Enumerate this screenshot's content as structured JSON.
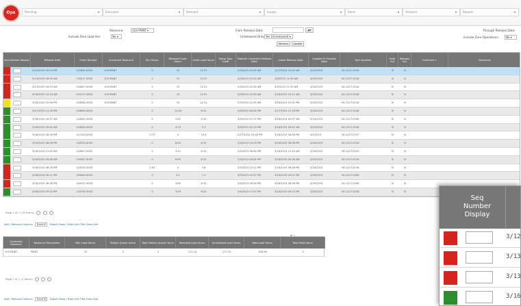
{
  "app": {
    "logo_text": "Ops"
  },
  "nav": [
    {
      "label": "Planning"
    },
    {
      "label": "Execution"
    },
    {
      "label": "Demand"
    },
    {
      "label": "Supply"
    },
    {
      "label": "Items"
    },
    {
      "label": "Analyzer"
    },
    {
      "label": "Reports"
    }
  ],
  "filters": {
    "resource_label": "Resource:",
    "resource_value": "103-PAINT",
    "zero_load_label": "Include Zero Load Hrs:",
    "zero_load_value": "No",
    "from_date_label": "From Release Date:",
    "unreleased_label": "Unreleased Only:",
    "unreleased_value": "Yes (Unreleased)",
    "through_date_label": "Through Release Date:",
    "zero_ops_label": "Include Zero Operations:",
    "zero_ops_value": "No",
    "retrieve_label": "Retrieve",
    "update_label": "Update"
  },
  "grid": {
    "columns": [
      "Seq Number Display",
      "Release Date",
      "Order Number",
      "Constraint Resource",
      "Run Hours",
      "Released Load Hours",
      "Order Load Hours",
      "Setup Type Code",
      "Material Constraint Release Date",
      "Latest Release Date",
      "Capable To Promise Date",
      "Item Number",
      "Hold Ind",
      "Release Ind",
      "Comment 1",
      "Comment"
    ],
    "rows": [
      {
        "status": "red",
        "release": "2/13/2015 09:14 PM",
        "order": "115854-0004",
        "constraint": "103-PAINT",
        "run": "0",
        "released": "15",
        "load": "12.51",
        "mat": "2/3/2015 02:45 AM",
        "latest": "12/7/2015 10:00 AM",
        "ctp": "2/20/2015",
        "item": "04-1227-0216",
        "hold": "N",
        "rel": "N"
      },
      {
        "status": "red",
        "release": "3/13/2015 04:35 AM",
        "order": "116417-0004",
        "constraint": "103-PAINT",
        "run": "0",
        "released": "15",
        "load": "12.51",
        "mat": "2/3/2015 02:45 AM",
        "latest": "3/9/2015 11:55 AM",
        "ctp": "3/20/2015",
        "item": "04-1227-0216",
        "hold": "N",
        "rel": "N"
      },
      {
        "status": "red",
        "release": "3/13/2015 04:53 AM",
        "order": "116407-0004",
        "constraint": "103-PAINT",
        "run": "0",
        "released": "15",
        "load": "12.51",
        "mat": "2/3/2015 02:45 AM",
        "latest": "3/9/2015 11:55 AM",
        "ctp": "3/20/2015",
        "item": "04-1227-0216",
        "hold": "N",
        "rel": "N"
      },
      {
        "status": "red",
        "release": "3/16/2015 10:13 AM",
        "order": "116117-0004",
        "constraint": "103-PAINT",
        "run": "0",
        "released": "15",
        "load": "12.51",
        "mat": "2/3/2015 02:45 AM",
        "latest": "3/16/2015 10:11 AM",
        "ctp": "3/20/2015",
        "item": "04-1227-0216",
        "hold": "N",
        "rel": "N"
      },
      {
        "status": "yellow",
        "release": "3/16/2015 10:58 PM",
        "order": "116584-0003",
        "constraint": "103-PAINT",
        "run": "0",
        "released": "15",
        "load": "12.51",
        "mat": "2/3/2015 02:45 AM",
        "latest": "3/16/2015 10:31 PM",
        "ctp": "3/20/2015",
        "item": "04-1227-0216",
        "hold": "N",
        "rel": "N"
      },
      {
        "status": "green",
        "release": "3/17/2015 11:18 PM",
        "order": "116604-0003",
        "constraint": "",
        "run": "0",
        "released": "12.85",
        "load": "6.31",
        "mat": "2/3/2015 06:34 PM",
        "latest": "2/17/2015 11:18 PM",
        "ctp": "3/20/2015",
        "item": "04-1227-0216",
        "hold": "N",
        "rel": "N"
      },
      {
        "status": "green",
        "release": "3/16/2015 04:37 AM",
        "order": "116091-0003",
        "constraint": "",
        "run": "0",
        "released": "3.81",
        "load": "6.31",
        "mat": "3/4/2015 07:11 PM",
        "latest": "3/16/2015 04:37 AM",
        "ctp": "3/24/2015",
        "item": "04-1227-0206",
        "hold": "N",
        "rel": "N"
      },
      {
        "status": "green",
        "release": "3/16/2015 09:42 AM",
        "order": "116504-0003",
        "constraint": "",
        "run": "0",
        "released": "4.79",
        "load": "3.1",
        "mat": "3/5/2015 02:19 PM",
        "latest": "3/16/2015 09:42 AM",
        "ctp": "3/20/2015",
        "item": "04-1227-0216",
        "hold": "N",
        "rel": "N"
      },
      {
        "status": "green",
        "release": "3/16/2015 06:26 PM",
        "order": "117140-0009",
        "constraint": "",
        "run": "2.73",
        "released": "0",
        "load": "14.4",
        "mat": "2/27/2015 03:48 PM",
        "latest": "3/16/2015 06:26 PM",
        "ctp": "4/1/2015",
        "item": "04-1227-0707",
        "hold": "N",
        "rel": "N"
      },
      {
        "status": "green",
        "release": "3/19/2015 06:28 PM",
        "order": "116720-0003",
        "constraint": "",
        "run": "0",
        "released": "6.45",
        "load": "6.31",
        "mat": "2/4/2015 04:19 PM",
        "latest": "3/19/2015 06:28 PM",
        "ctp": "3/20/2015",
        "item": "04-1227-0216",
        "hold": "N",
        "rel": "N"
      },
      {
        "status": "green",
        "release": "3/20/2015 11:50 AM",
        "order": "116407-0002",
        "constraint": "",
        "run": "0",
        "released": "3.21",
        "load": "6.31",
        "mat": "2/4/2015 06:34 PM",
        "latest": "3/16/2015 11:50 AM",
        "ctp": "3/20/2015",
        "item": "04-1227-0222",
        "hold": "N",
        "rel": "N"
      },
      {
        "status": "green",
        "release": "3/16/2015 05:56 AM",
        "order": "116307-0003",
        "constraint": "",
        "run": "0",
        "released": "6.82",
        "load": "6.31",
        "mat": "2/4/2015 06:34 PM",
        "latest": "3/16/2015 05:56 AM",
        "ctp": "3/20/2015",
        "item": "04-1227-0216",
        "hold": "N",
        "rel": "N"
      },
      {
        "status": "red",
        "release": "3/16/2015 06:28 PM",
        "order": "116730-0003",
        "constraint": "",
        "run": "1.63",
        "released": "0",
        "load": "3.6",
        "mat": "2/5/2015 10:21 PM",
        "latest": "3/16/2015 06:28 PM",
        "ctp": "3/20/2015",
        "item": "04-1227-0216",
        "hold": "N",
        "rel": "N"
      },
      {
        "status": "red",
        "release": "3/16/2015 05:11 PM",
        "order": "116440-0003",
        "constraint": "",
        "run": "0",
        "released": "3.1",
        "load": "7.3",
        "mat": "3/5/2015 02:47 PM",
        "latest": "3/16/2015 05:11 PM",
        "ctp": "3/20/2015",
        "item": "04-1227-0206",
        "hold": "N",
        "rel": "N"
      },
      {
        "status": "red",
        "release": "3/16/2015 08:58 PM",
        "order": "116157-0003",
        "constraint": "",
        "run": "0",
        "released": "3.65",
        "load": "6.31",
        "mat": "2/4/2015 06:34 PM",
        "latest": "3/16/2015 08:58 PM",
        "ctp": "3/20/2015",
        "item": "04-1227-0206",
        "hold": "N",
        "rel": "N"
      },
      {
        "status": "green",
        "release": "3/16/2015 09:10 PM",
        "order": "116730-0003",
        "constraint": "",
        "run": "0",
        "released": "3.49",
        "load": "6.31",
        "mat": "2/4/2015 07:10 PM",
        "latest": "3/16/2015 09:10 PM",
        "ctp": "3/20/2015",
        "item": "04-1227-0216",
        "hold": "N",
        "rel": "N"
      }
    ]
  },
  "pager1": {
    "text": "Page 1 of 1 (16 Items)"
  },
  "toolbar1": {
    "add_remove": "Add / Remove Columns",
    "export_format": "Excel",
    "export": "Export",
    "show_hide": "Show / Hide Grid Title",
    "clear_sort": "Clear Sort"
  },
  "grid2": {
    "columns": [
      "Constraint Resource",
      "Resource Description",
      "Max Load Hours",
      "Protect Queue Hours",
      "Total Protect Queue Hours",
      "Released Load Hours",
      "Unreleased Load Hours",
      "Total Load Hours",
      "Total Held Hours"
    ],
    "row": [
      "103-PAINT",
      "PAINT",
      "15",
      "2",
      "5",
      "131.14",
      "177.32",
      "308.46",
      "0"
    ]
  },
  "pager2": {
    "text": "Page 1 of 1 (1 Items)"
  },
  "toolbar2": {
    "add_remove": "Add / Remove Columns",
    "export_format": "Excel",
    "export": "Export",
    "show_hide": "Show / Hide Grid Title",
    "clear_sort": "Clear Sort"
  },
  "zoom": {
    "header": "Seq Number Display",
    "rows": [
      {
        "status": "red",
        "date": "3/12"
      },
      {
        "status": "red",
        "date": "3/13"
      },
      {
        "status": "red",
        "date": "3/13"
      },
      {
        "status": "green",
        "date": "3/16"
      }
    ]
  },
  "colors": {
    "red": "#d6231b",
    "yellow": "#f1e30f",
    "green": "#2b8f2b",
    "header": "#757575",
    "selected": "#bfe1f3",
    "logo": "#d9261c"
  }
}
